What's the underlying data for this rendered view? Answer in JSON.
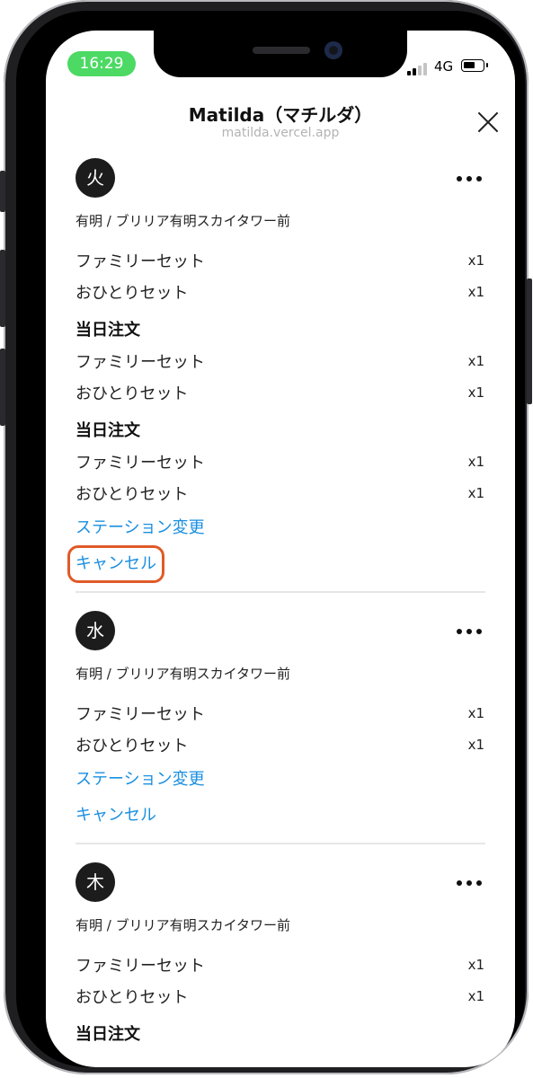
{
  "status_bar": {
    "time": "16:29",
    "network": "4G"
  },
  "header": {
    "title": "Matilda（マチルダ）",
    "subtitle": "matilda.vercel.app"
  },
  "days": [
    {
      "badge": "火",
      "station": "有明 / ブリリア有明スカイタワー前",
      "groups": [
        {
          "title": "",
          "items": [
            {
              "name": "ファミリーセット",
              "qty": "x1"
            },
            {
              "name": "おひとりセット",
              "qty": "x1"
            }
          ]
        },
        {
          "title": "当日注文",
          "items": [
            {
              "name": "ファミリーセット",
              "qty": "x1"
            },
            {
              "name": "おひとりセット",
              "qty": "x1"
            }
          ]
        },
        {
          "title": "当日注文",
          "items": [
            {
              "name": "ファミリーセット",
              "qty": "x1"
            },
            {
              "name": "おひとりセット",
              "qty": "x1"
            }
          ]
        }
      ],
      "change_station": "ステーション変更",
      "cancel": "キャンセル",
      "cancel_highlighted": true
    },
    {
      "badge": "水",
      "station": "有明 / ブリリア有明スカイタワー前",
      "groups": [
        {
          "title": "",
          "items": [
            {
              "name": "ファミリーセット",
              "qty": "x1"
            },
            {
              "name": "おひとりセット",
              "qty": "x1"
            }
          ]
        }
      ],
      "change_station": "ステーション変更",
      "cancel": "キャンセル",
      "cancel_highlighted": false
    },
    {
      "badge": "木",
      "station": "有明 / ブリリア有明スカイタワー前",
      "groups": [
        {
          "title": "",
          "items": [
            {
              "name": "ファミリーセット",
              "qty": "x1"
            },
            {
              "name": "おひとりセット",
              "qty": "x1"
            }
          ]
        },
        {
          "title": "当日注文",
          "items": []
        }
      ],
      "change_station": "",
      "cancel": "",
      "cancel_highlighted": false
    }
  ],
  "colors": {
    "link": "#1a8fe0",
    "highlight_outline": "#e05a28",
    "status_pill": "#4cd964",
    "badge_bg": "#1c1c1c"
  },
  "icons": {
    "close": "close-icon",
    "more": "more-icon",
    "signal": "signal-icon",
    "battery": "battery-icon"
  }
}
